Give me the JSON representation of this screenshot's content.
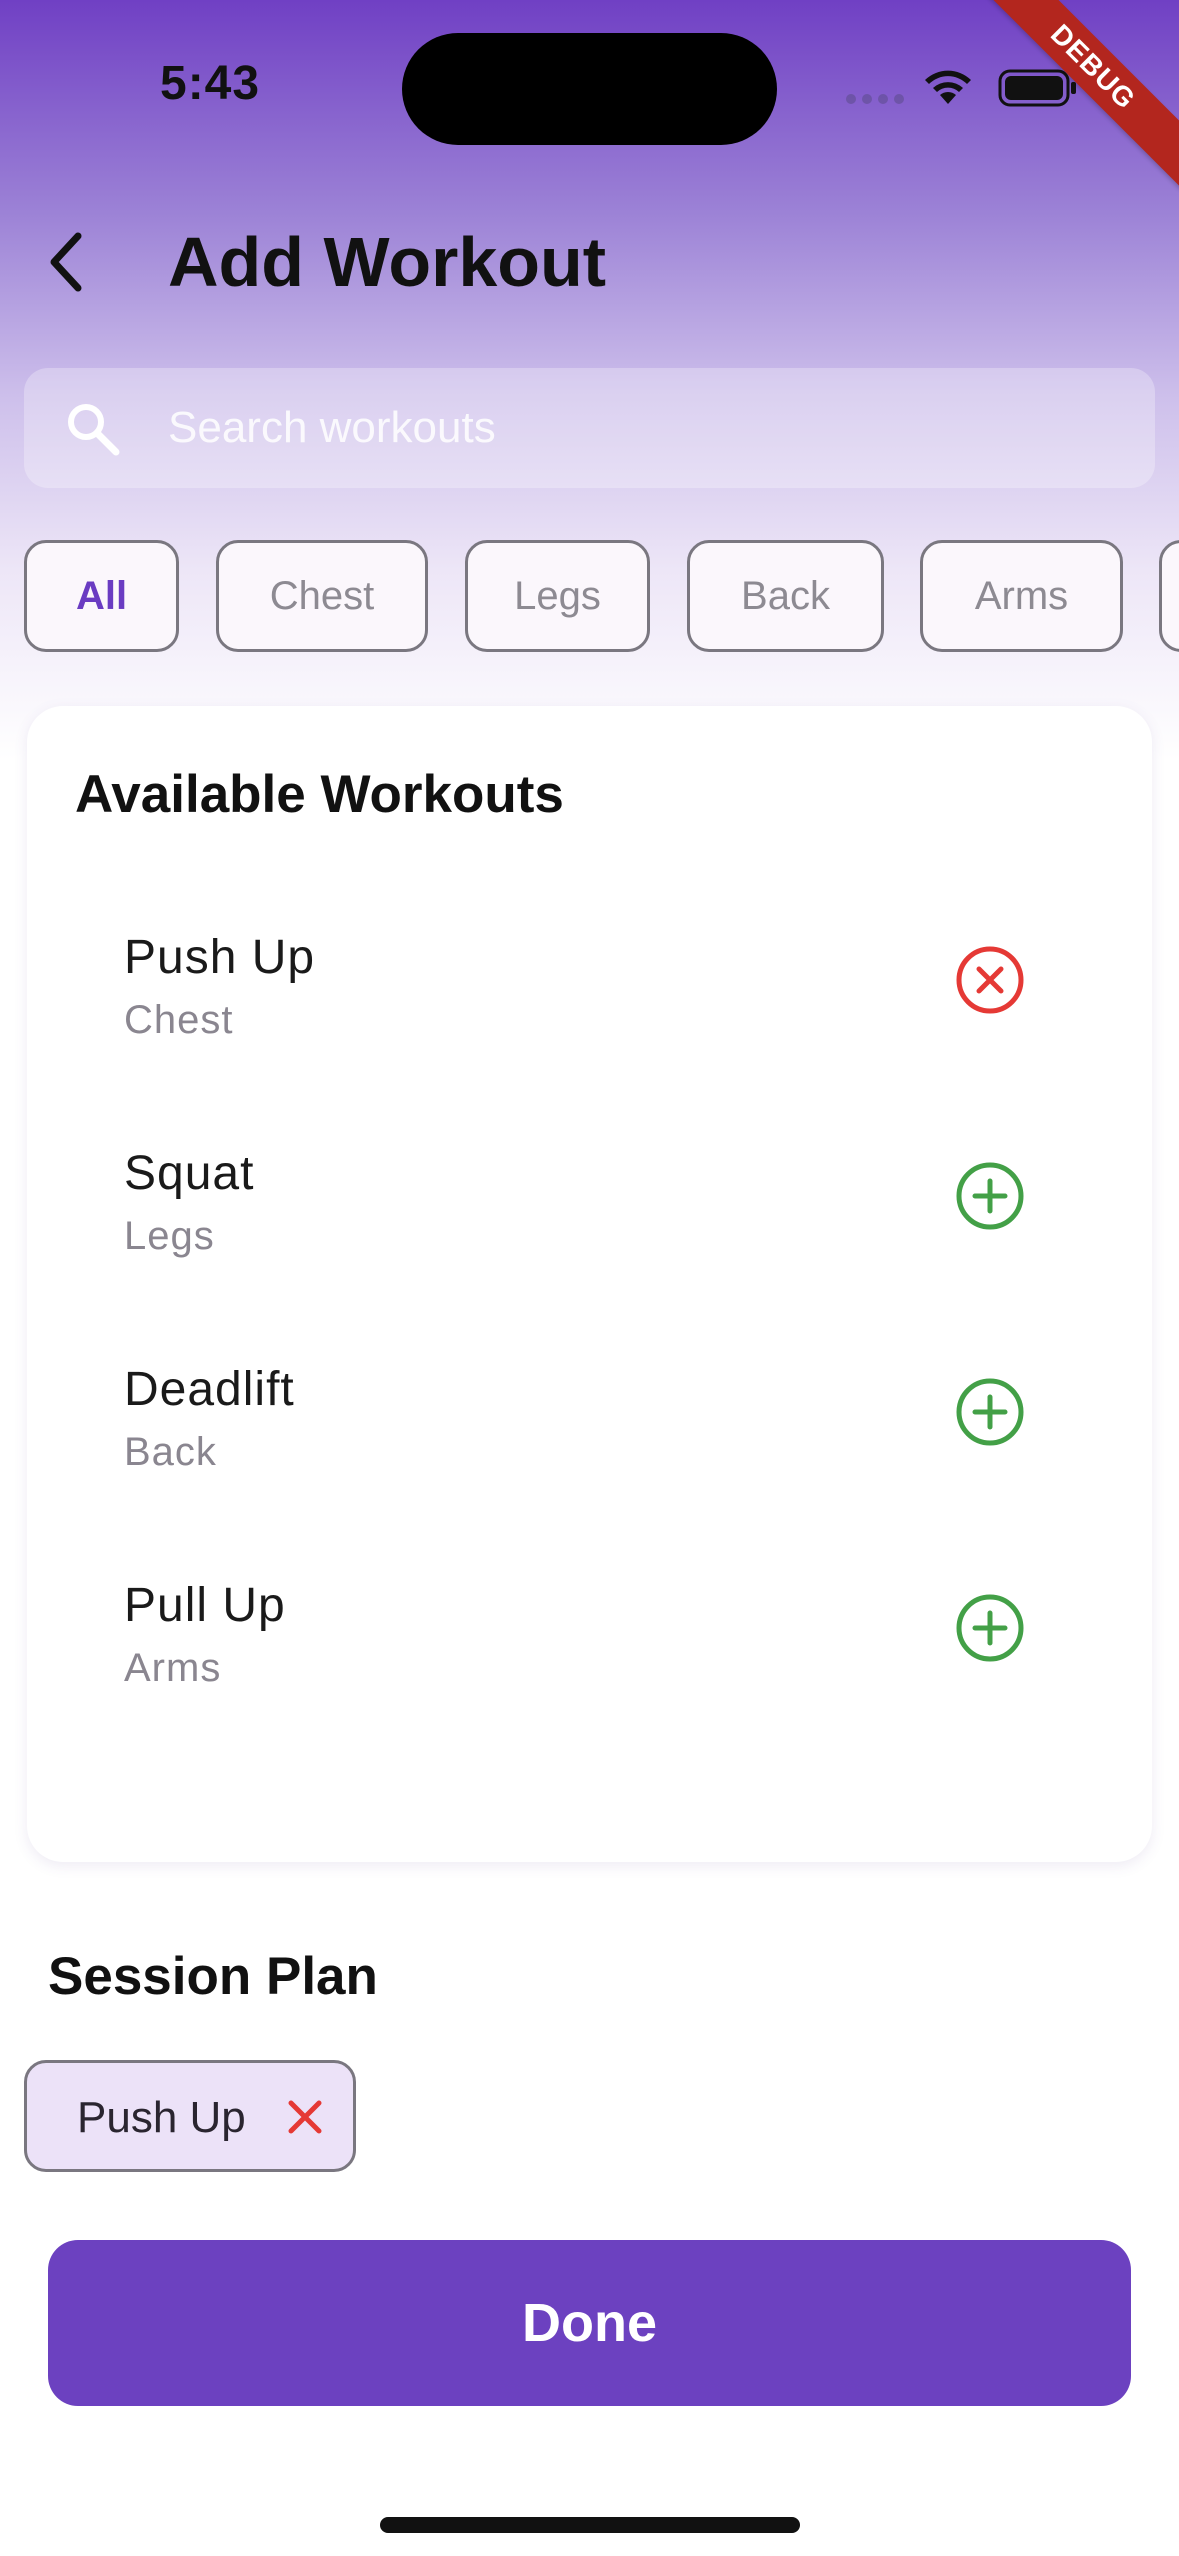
{
  "status_bar": {
    "time": "5:43",
    "debug_label": "DEBUG"
  },
  "header": {
    "title": "Add Workout"
  },
  "search": {
    "placeholder": "Search workouts"
  },
  "filters": [
    {
      "label": "All",
      "selected": true
    },
    {
      "label": "Chest",
      "selected": false
    },
    {
      "label": "Legs",
      "selected": false
    },
    {
      "label": "Back",
      "selected": false
    },
    {
      "label": "Arms",
      "selected": false
    }
  ],
  "available": {
    "title": "Available Workouts",
    "items": [
      {
        "name": "Push Up",
        "category": "Chest",
        "action": "remove",
        "icon": "remove-circle-icon"
      },
      {
        "name": "Squat",
        "category": "Legs",
        "action": "add",
        "icon": "add-circle-icon"
      },
      {
        "name": "Deadlift",
        "category": "Back",
        "action": "add",
        "icon": "add-circle-icon"
      },
      {
        "name": "Pull Up",
        "category": "Arms",
        "action": "add",
        "icon": "add-circle-icon"
      }
    ]
  },
  "session": {
    "title": "Session Plan",
    "items": [
      {
        "label": "Push Up"
      }
    ]
  },
  "done_label": "Done",
  "colors": {
    "accent": "#6c41c0",
    "add": "#43a047",
    "remove": "#e53935",
    "chip_text": "#8d8a92"
  }
}
